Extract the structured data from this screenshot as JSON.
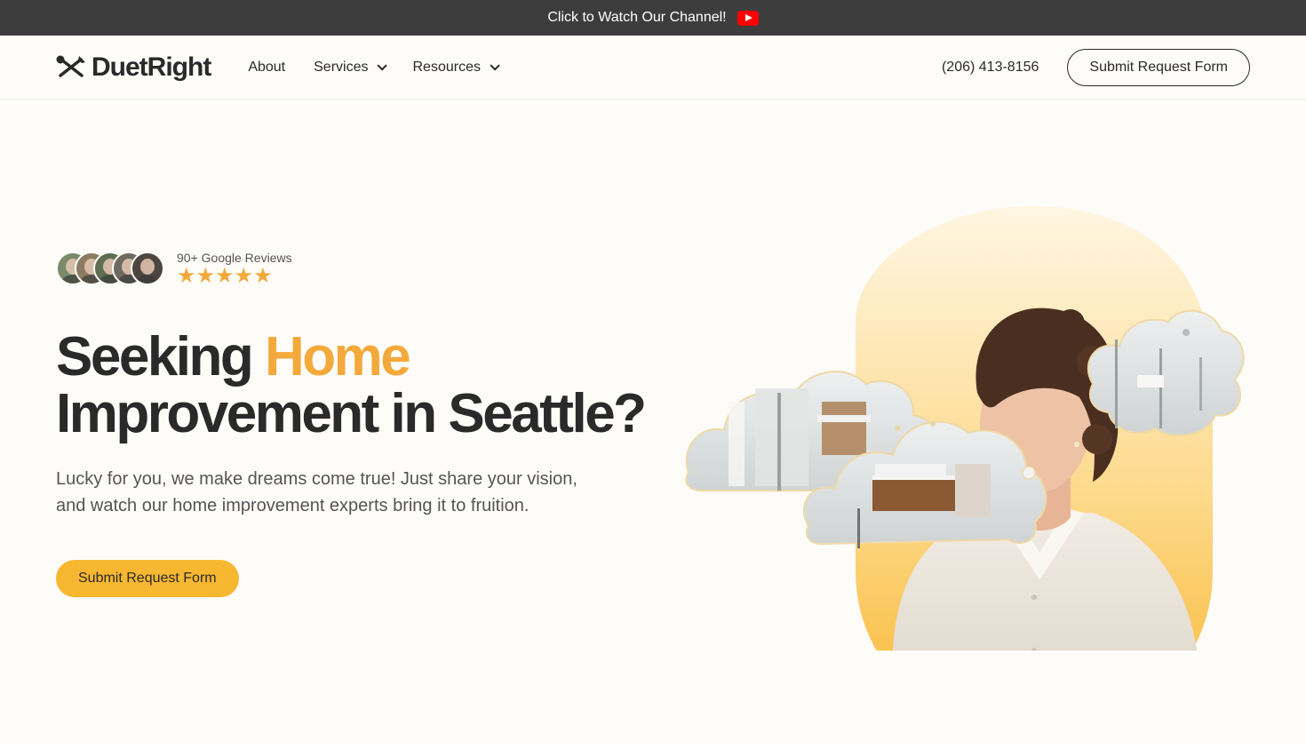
{
  "topbar": {
    "text": "Click to Watch Our Channel!",
    "icon": "youtube-icon",
    "icon_color": "#ff0000"
  },
  "nav": {
    "logo_text": "DuetRight",
    "logo_icon": "tools-icon",
    "links": [
      {
        "label": "About",
        "has_dropdown": false
      },
      {
        "label": "Services",
        "has_dropdown": true
      },
      {
        "label": "Resources",
        "has_dropdown": true
      }
    ],
    "phone": "(206) 413-8156",
    "cta_label": "Submit Request Form"
  },
  "hero": {
    "reviews_text": "90+ Google Reviews",
    "rating": 5,
    "stars": "★★★★★",
    "headline_part1": "Seeking ",
    "headline_accent": "Home",
    "headline_part2": "Improvement in Seattle?",
    "subtext": "Lucky for you, we make dreams come true! Just share your vision, and watch our home improvement experts bring it to fruition.",
    "cta_label": "Submit Request Form"
  },
  "colors": {
    "accent": "#f4a93b",
    "button_primary": "#f7b731",
    "topbar_bg": "#3d3d3d",
    "page_bg": "#fdfcf9",
    "text": "#2a2a2a"
  }
}
